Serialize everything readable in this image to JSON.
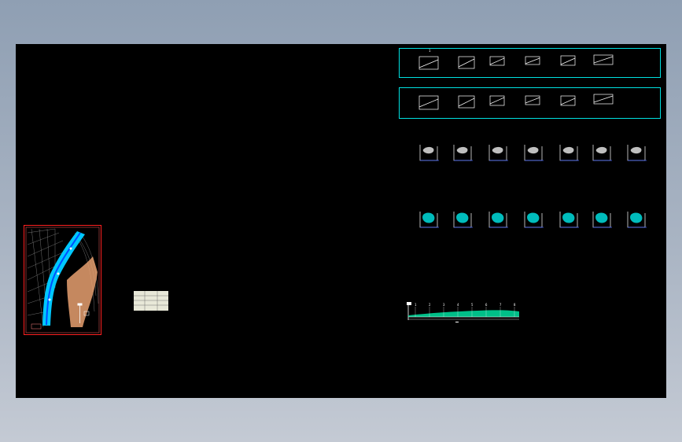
{
  "window": {
    "title": ""
  },
  "drawing": {
    "background": "#000000",
    "workspace_color": "#a3afbf",
    "frame_color": "#00e0e0",
    "site_plan": {
      "border_color": "#ff2020",
      "river_color": "#00c8ff",
      "slope_color": "#e8a070",
      "north_arrow_icon": "north-arrow-icon"
    },
    "legend_table": {
      "fill": "#e8e8d8"
    },
    "slope_rows": [
      {
        "items": 6,
        "marker": "1"
      },
      {
        "items": 6
      }
    ],
    "section_rows": [
      {
        "items": 7
      },
      {
        "items": 7
      }
    ],
    "profile": {
      "color": "#00e0a0",
      "station_labels": [
        "1",
        "2",
        "3",
        "4",
        "5",
        "6",
        "7",
        "8"
      ]
    }
  }
}
